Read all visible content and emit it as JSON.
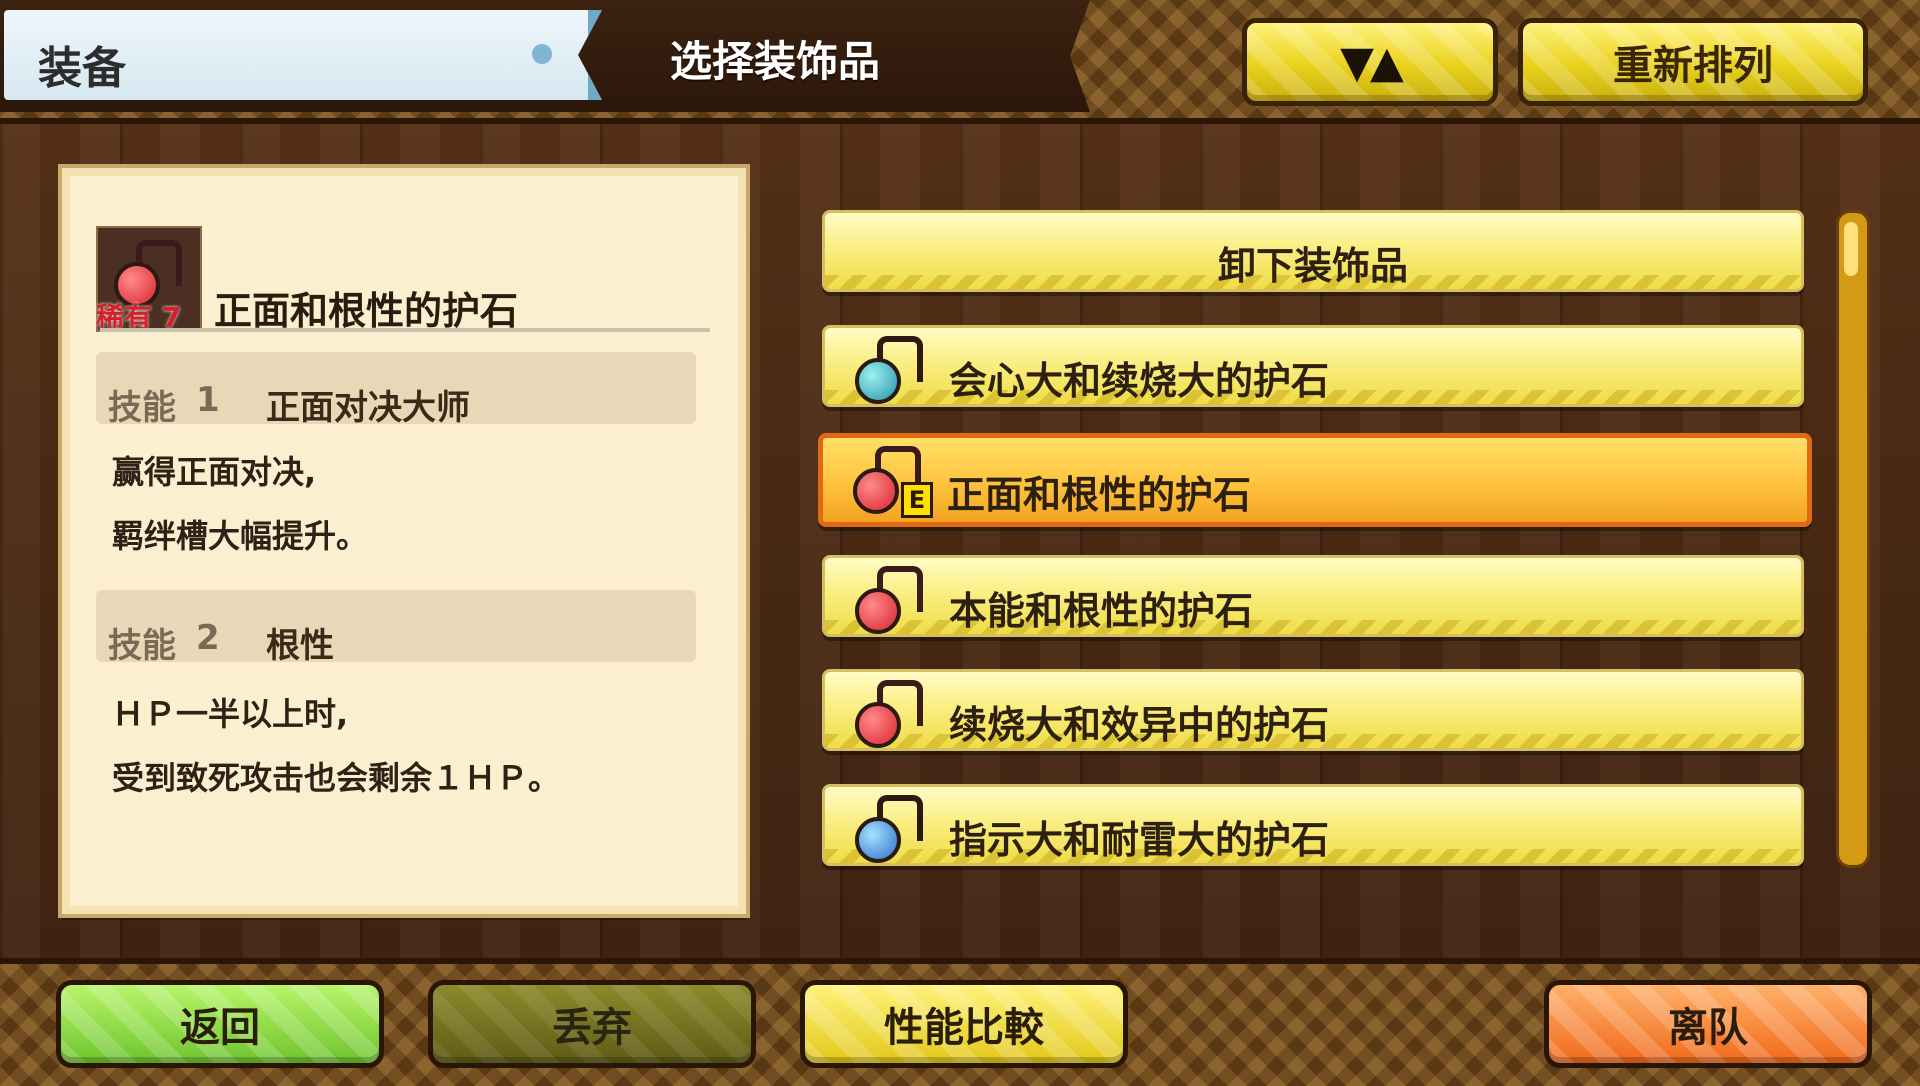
{
  "header": {
    "tab_label": "装备",
    "title": "选择装饰品",
    "sort_label": "▼▲",
    "reorder_label": "重新排列"
  },
  "detail": {
    "rarity": "稀有 7",
    "item_name": "正面和根性的护石",
    "skills": [
      {
        "tag": "技能",
        "num": "1",
        "name": "正面对决大师",
        "desc_lines": [
          "赢得正面对决,",
          "羁绊槽大幅提升。"
        ]
      },
      {
        "tag": "技能",
        "num": "2",
        "name": "根性",
        "desc_lines": [
          "ＨＰ一半以上时,",
          "受到致死攻击也会剩余１ＨＰ。"
        ]
      }
    ]
  },
  "list": {
    "remove_label": "卸下装饰品",
    "items": [
      {
        "label": "会心大和续烧大的护石",
        "icon": "charm-teal-icon",
        "selected": false
      },
      {
        "label": "正面和根性的护石",
        "icon": "charm-red-icon",
        "selected": true,
        "equipped_mark": "E"
      },
      {
        "label": "本能和根性的护石",
        "icon": "charm-red-icon",
        "selected": false
      },
      {
        "label": "续烧大和效异中的护石",
        "icon": "charm-red-icon",
        "selected": false
      },
      {
        "label": "指示大和耐雷大的护石",
        "icon": "charm-blue-icon",
        "selected": false
      }
    ]
  },
  "footer": {
    "back": "返回",
    "discard": "丢弃",
    "compare": "性能比較",
    "leave": "离队"
  },
  "colors": {
    "accent_yellow": "#f0dc46",
    "selected_orange": "#f3a322",
    "back_green": "#6fc42e",
    "leave_orange": "#f06a1c",
    "rarity_red": "#d8202a"
  }
}
